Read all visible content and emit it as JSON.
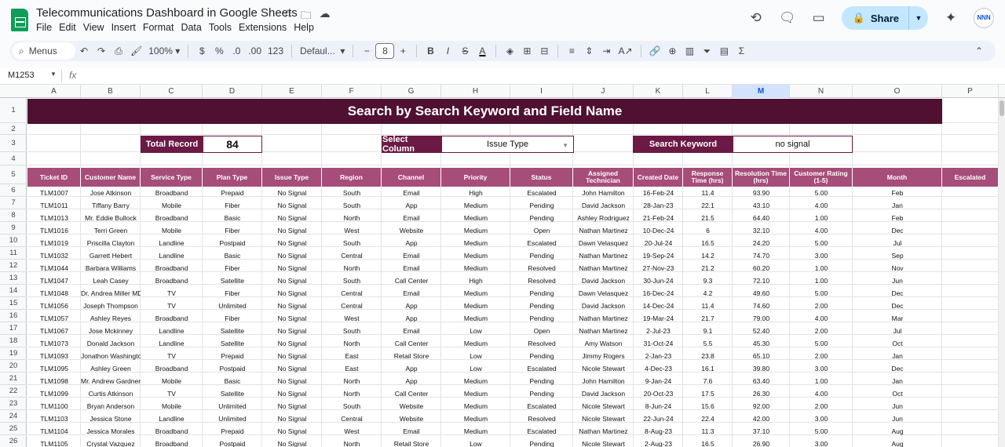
{
  "app": {
    "title": "Telecommunications Dashboard in Google Sheets",
    "menu": [
      "File",
      "Edit",
      "View",
      "Insert",
      "Format",
      "Data",
      "Tools",
      "Extensions",
      "Help"
    ],
    "share_label": "Share",
    "avatar_text": "NNN"
  },
  "toolbar": {
    "search_label": "Menus",
    "zoom": "100%",
    "currency": "$",
    "percent": "%",
    "dec_decrease": ".0",
    "dec_increase": ".00",
    "number_format": "123",
    "font": "Defaul...",
    "font_size": "8"
  },
  "formula_bar": {
    "cell_ref": "M1253",
    "fx": "fx"
  },
  "columns": [
    "A",
    "B",
    "C",
    "D",
    "E",
    "F",
    "G",
    "H",
    "I",
    "J",
    "K",
    "L",
    "M",
    "N",
    "O",
    "P"
  ],
  "selected_column": "M",
  "rows": [
    "1",
    "2",
    "3",
    "4",
    "5",
    "6",
    "7",
    "8",
    "9",
    "10",
    "11",
    "12",
    "13",
    "14",
    "15",
    "16",
    "17",
    "18",
    "19",
    "20",
    "21",
    "22",
    "23",
    "24",
    "25",
    "26"
  ],
  "dashboard": {
    "title": "Search by Search Keyword and Field Name",
    "total_record_label": "Total Record",
    "total_record_value": "84",
    "select_column_label": "Select Column",
    "select_column_value": "Issue Type",
    "search_keyword_label": "Search Keyword",
    "search_keyword_value": "no signal"
  },
  "table": {
    "headers": [
      "Ticket ID",
      "Customer Name",
      "Service Type",
      "Plan Type",
      "Issue Type",
      "Region",
      "Channel",
      "Priority",
      "Status",
      "Assigned Technician",
      "Created Date",
      "Response Time (hrs)",
      "Resolution Time (hrs)",
      "Customer Rating (1-5)",
      "Month",
      "Escalated"
    ],
    "rows": [
      [
        "TLM1007",
        "Jose Atkinson",
        "Broadband",
        "Prepaid",
        "No Signal",
        "South",
        "Email",
        "High",
        "Escalated",
        "John Hamilton",
        "16-Feb-24",
        "11.4",
        "93.90",
        "5.00",
        "Feb",
        ""
      ],
      [
        "TLM1011",
        "Tiffany Barry",
        "Mobile",
        "Fiber",
        "No Signal",
        "South",
        "App",
        "Medium",
        "Pending",
        "David Jackson",
        "28-Jan-23",
        "22.1",
        "43.10",
        "4.00",
        "Jan",
        ""
      ],
      [
        "TLM1013",
        "Mr. Eddie Bullock",
        "Broadband",
        "Basic",
        "No Signal",
        "North",
        "Email",
        "Medium",
        "Pending",
        "Ashley Rodriguez",
        "21-Feb-24",
        "21.5",
        "64.40",
        "1.00",
        "Feb",
        ""
      ],
      [
        "TLM1016",
        "Terri Green",
        "Mobile",
        "Fiber",
        "No Signal",
        "West",
        "Website",
        "Medium",
        "Open",
        "Nathan Martinez",
        "10-Dec-24",
        "6",
        "32.10",
        "4.00",
        "Dec",
        ""
      ],
      [
        "TLM1019",
        "Priscilla Clayton",
        "Landline",
        "Postpaid",
        "No Signal",
        "South",
        "App",
        "Medium",
        "Escalated",
        "Dawn Velasquez",
        "20-Jul-24",
        "16.5",
        "24.20",
        "5.00",
        "Jul",
        ""
      ],
      [
        "TLM1032",
        "Garrett Hebert",
        "Landline",
        "Basic",
        "No Signal",
        "Central",
        "Email",
        "Medium",
        "Pending",
        "Nathan Martinez",
        "19-Sep-24",
        "14.2",
        "74.70",
        "3.00",
        "Sep",
        ""
      ],
      [
        "TLM1044",
        "Barbara Williams",
        "Broadband",
        "Fiber",
        "No Signal",
        "North",
        "Email",
        "Medium",
        "Resolved",
        "Nathan Martinez",
        "27-Nov-23",
        "21.2",
        "60.20",
        "1.00",
        "Nov",
        ""
      ],
      [
        "TLM1047",
        "Leah Casey",
        "Broadband",
        "Satellite",
        "No Signal",
        "South",
        "Call Center",
        "High",
        "Resolved",
        "David Jackson",
        "30-Jun-24",
        "9.3",
        "72.10",
        "1.00",
        "Jun",
        ""
      ],
      [
        "TLM1048",
        "Dr. Andrea Miller MD",
        "TV",
        "Fiber",
        "No Signal",
        "Central",
        "Email",
        "Medium",
        "Pending",
        "Dawn Velasquez",
        "16-Dec-24",
        "4.2",
        "49.60",
        "5.00",
        "Dec",
        ""
      ],
      [
        "TLM1056",
        "Joseph Thompson",
        "TV",
        "Unlimited",
        "No Signal",
        "Central",
        "App",
        "Medium",
        "Pending",
        "David Jackson",
        "14-Dec-24",
        "11.4",
        "74.60",
        "2.00",
        "Dec",
        ""
      ],
      [
        "TLM1057",
        "Ashley Reyes",
        "Broadband",
        "Fiber",
        "No Signal",
        "West",
        "App",
        "Medium",
        "Pending",
        "Nathan Martinez",
        "19-Mar-24",
        "21.7",
        "79.00",
        "4.00",
        "Mar",
        ""
      ],
      [
        "TLM1067",
        "Jose Mckinney",
        "Landline",
        "Satellite",
        "No Signal",
        "South",
        "Email",
        "Low",
        "Open",
        "Nathan Martinez",
        "2-Jul-23",
        "9.1",
        "52.40",
        "2.00",
        "Jul",
        ""
      ],
      [
        "TLM1073",
        "Donald Jackson",
        "Landline",
        "Satellite",
        "No Signal",
        "North",
        "Call Center",
        "Medium",
        "Resolved",
        "Amy Watson",
        "31-Oct-24",
        "5.5",
        "45.30",
        "5.00",
        "Oct",
        ""
      ],
      [
        "TLM1093",
        "Jonathon Washington",
        "TV",
        "Prepaid",
        "No Signal",
        "East",
        "Retail Store",
        "Low",
        "Pending",
        "Jimmy Rogers",
        "2-Jan-23",
        "23.8",
        "65.10",
        "2.00",
        "Jan",
        ""
      ],
      [
        "TLM1095",
        "Ashley Green",
        "Broadband",
        "Postpaid",
        "No Signal",
        "East",
        "App",
        "Low",
        "Escalated",
        "Nicole Stewart",
        "4-Dec-23",
        "16.1",
        "39.80",
        "3.00",
        "Dec",
        ""
      ],
      [
        "TLM1098",
        "Mr. Andrew Gardner",
        "Mobile",
        "Basic",
        "No Signal",
        "North",
        "App",
        "Medium",
        "Pending",
        "John Hamilton",
        "9-Jan-24",
        "7.6",
        "63.40",
        "1.00",
        "Jan",
        ""
      ],
      [
        "TLM1099",
        "Curtis Atkinson",
        "TV",
        "Satellite",
        "No Signal",
        "North",
        "Call Center",
        "Medium",
        "Pending",
        "David Jackson",
        "20-Oct-23",
        "17.5",
        "26.30",
        "4.00",
        "Oct",
        ""
      ],
      [
        "TLM1100",
        "Bryan Anderson",
        "Mobile",
        "Unlimited",
        "No Signal",
        "South",
        "Website",
        "Medium",
        "Escalated",
        "Nicole Stewart",
        "8-Jun-24",
        "15.6",
        "92.00",
        "2.00",
        "Jun",
        ""
      ],
      [
        "TLM1103",
        "Jessica Stone",
        "Landline",
        "Unlimited",
        "No Signal",
        "Central",
        "Website",
        "Medium",
        "Resolved",
        "Nicole Stewart",
        "22-Jun-24",
        "22.4",
        "42.00",
        "3.00",
        "Jun",
        ""
      ],
      [
        "TLM1104",
        "Jessica Morales",
        "Broadband",
        "Prepaid",
        "No Signal",
        "West",
        "Email",
        "Medium",
        "Escalated",
        "Nathan Martinez",
        "8-Aug-23",
        "11.3",
        "37.10",
        "5.00",
        "Aug",
        ""
      ],
      [
        "TLM1105",
        "Crystal Vazquez",
        "Broadband",
        "Postpaid",
        "No Signal",
        "North",
        "Retail Store",
        "Low",
        "Pending",
        "Nicole Stewart",
        "2-Aug-23",
        "16.5",
        "26.90",
        "3.00",
        "Aug",
        ""
      ]
    ]
  },
  "colors": {
    "banner": "#4f1032",
    "label": "#6b1a45",
    "header": "#a64d79",
    "share": "#c2e7ff"
  }
}
